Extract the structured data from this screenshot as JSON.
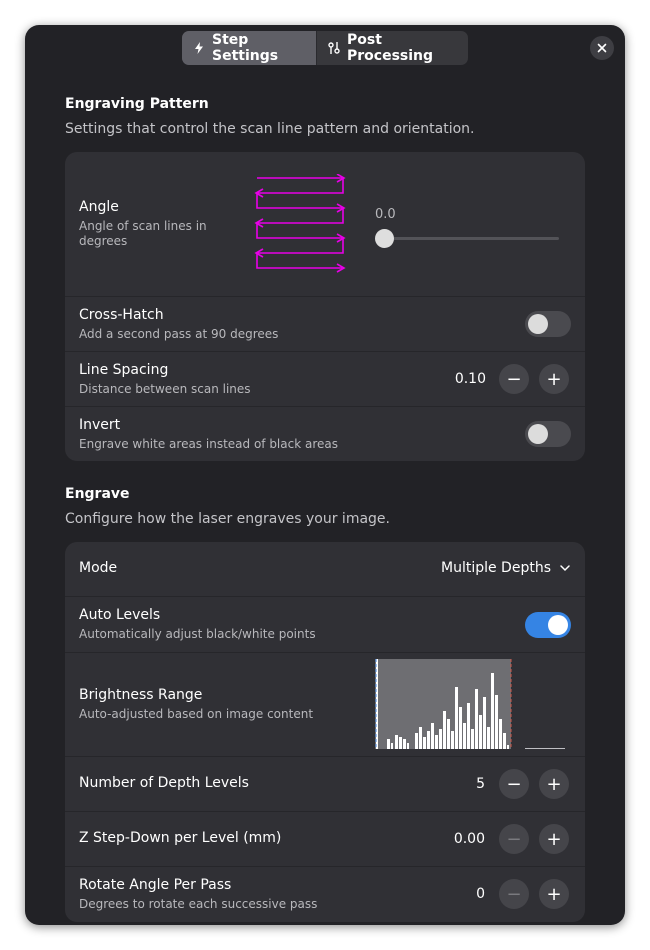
{
  "header": {
    "tabs": [
      {
        "label": "Step Settings",
        "icon": "lightning-icon",
        "active": true
      },
      {
        "label": "Post Processing",
        "icon": "sliders-icon",
        "active": false
      }
    ],
    "close_icon": "close-icon"
  },
  "engraving_pattern": {
    "title": "Engraving Pattern",
    "description": "Settings that control the scan line pattern and orientation.",
    "angle": {
      "title": "Angle",
      "subtitle_line1": "Angle of scan lines in",
      "subtitle_line2": "degrees",
      "value": "0.0",
      "slider_level": 0.0,
      "preview_color": "#e800e8"
    },
    "cross_hatch": {
      "title": "Cross-Hatch",
      "subtitle": "Add a second pass at 90 degrees",
      "enabled": false
    },
    "line_spacing": {
      "title": "Line Spacing",
      "subtitle": "Distance between scan lines",
      "value": "0.10",
      "minus": "−",
      "plus": "+"
    },
    "invert": {
      "title": "Invert",
      "subtitle": "Engrave white areas instead of black areas",
      "enabled": false
    }
  },
  "engrave": {
    "title": "Engrave",
    "description": "Configure how the laser engraves your image.",
    "mode": {
      "title": "Mode",
      "value": "Multiple Depths"
    },
    "auto_levels": {
      "title": "Auto Levels",
      "subtitle": "Automatically adjust black/white points",
      "enabled": true
    },
    "brightness_range": {
      "title": "Brightness Range",
      "subtitle": "Auto-adjusted based on image content"
    },
    "depth_levels": {
      "title": "Number of Depth Levels",
      "value": "5",
      "minus": "−",
      "plus": "+"
    },
    "z_step": {
      "title": "Z Step-Down per Level (mm)",
      "value": "0.00",
      "minus": "−",
      "plus": "+"
    },
    "rotate": {
      "title": "Rotate Angle Per Pass",
      "subtitle": "Degrees to rotate each successive pass",
      "value": "0",
      "minus": "−",
      "plus": "+"
    }
  },
  "colors": {
    "accent": "#3584e4",
    "window": "#222226",
    "card": "#303035",
    "pattern": "#e800e8",
    "range_marker": "#d0584a"
  }
}
